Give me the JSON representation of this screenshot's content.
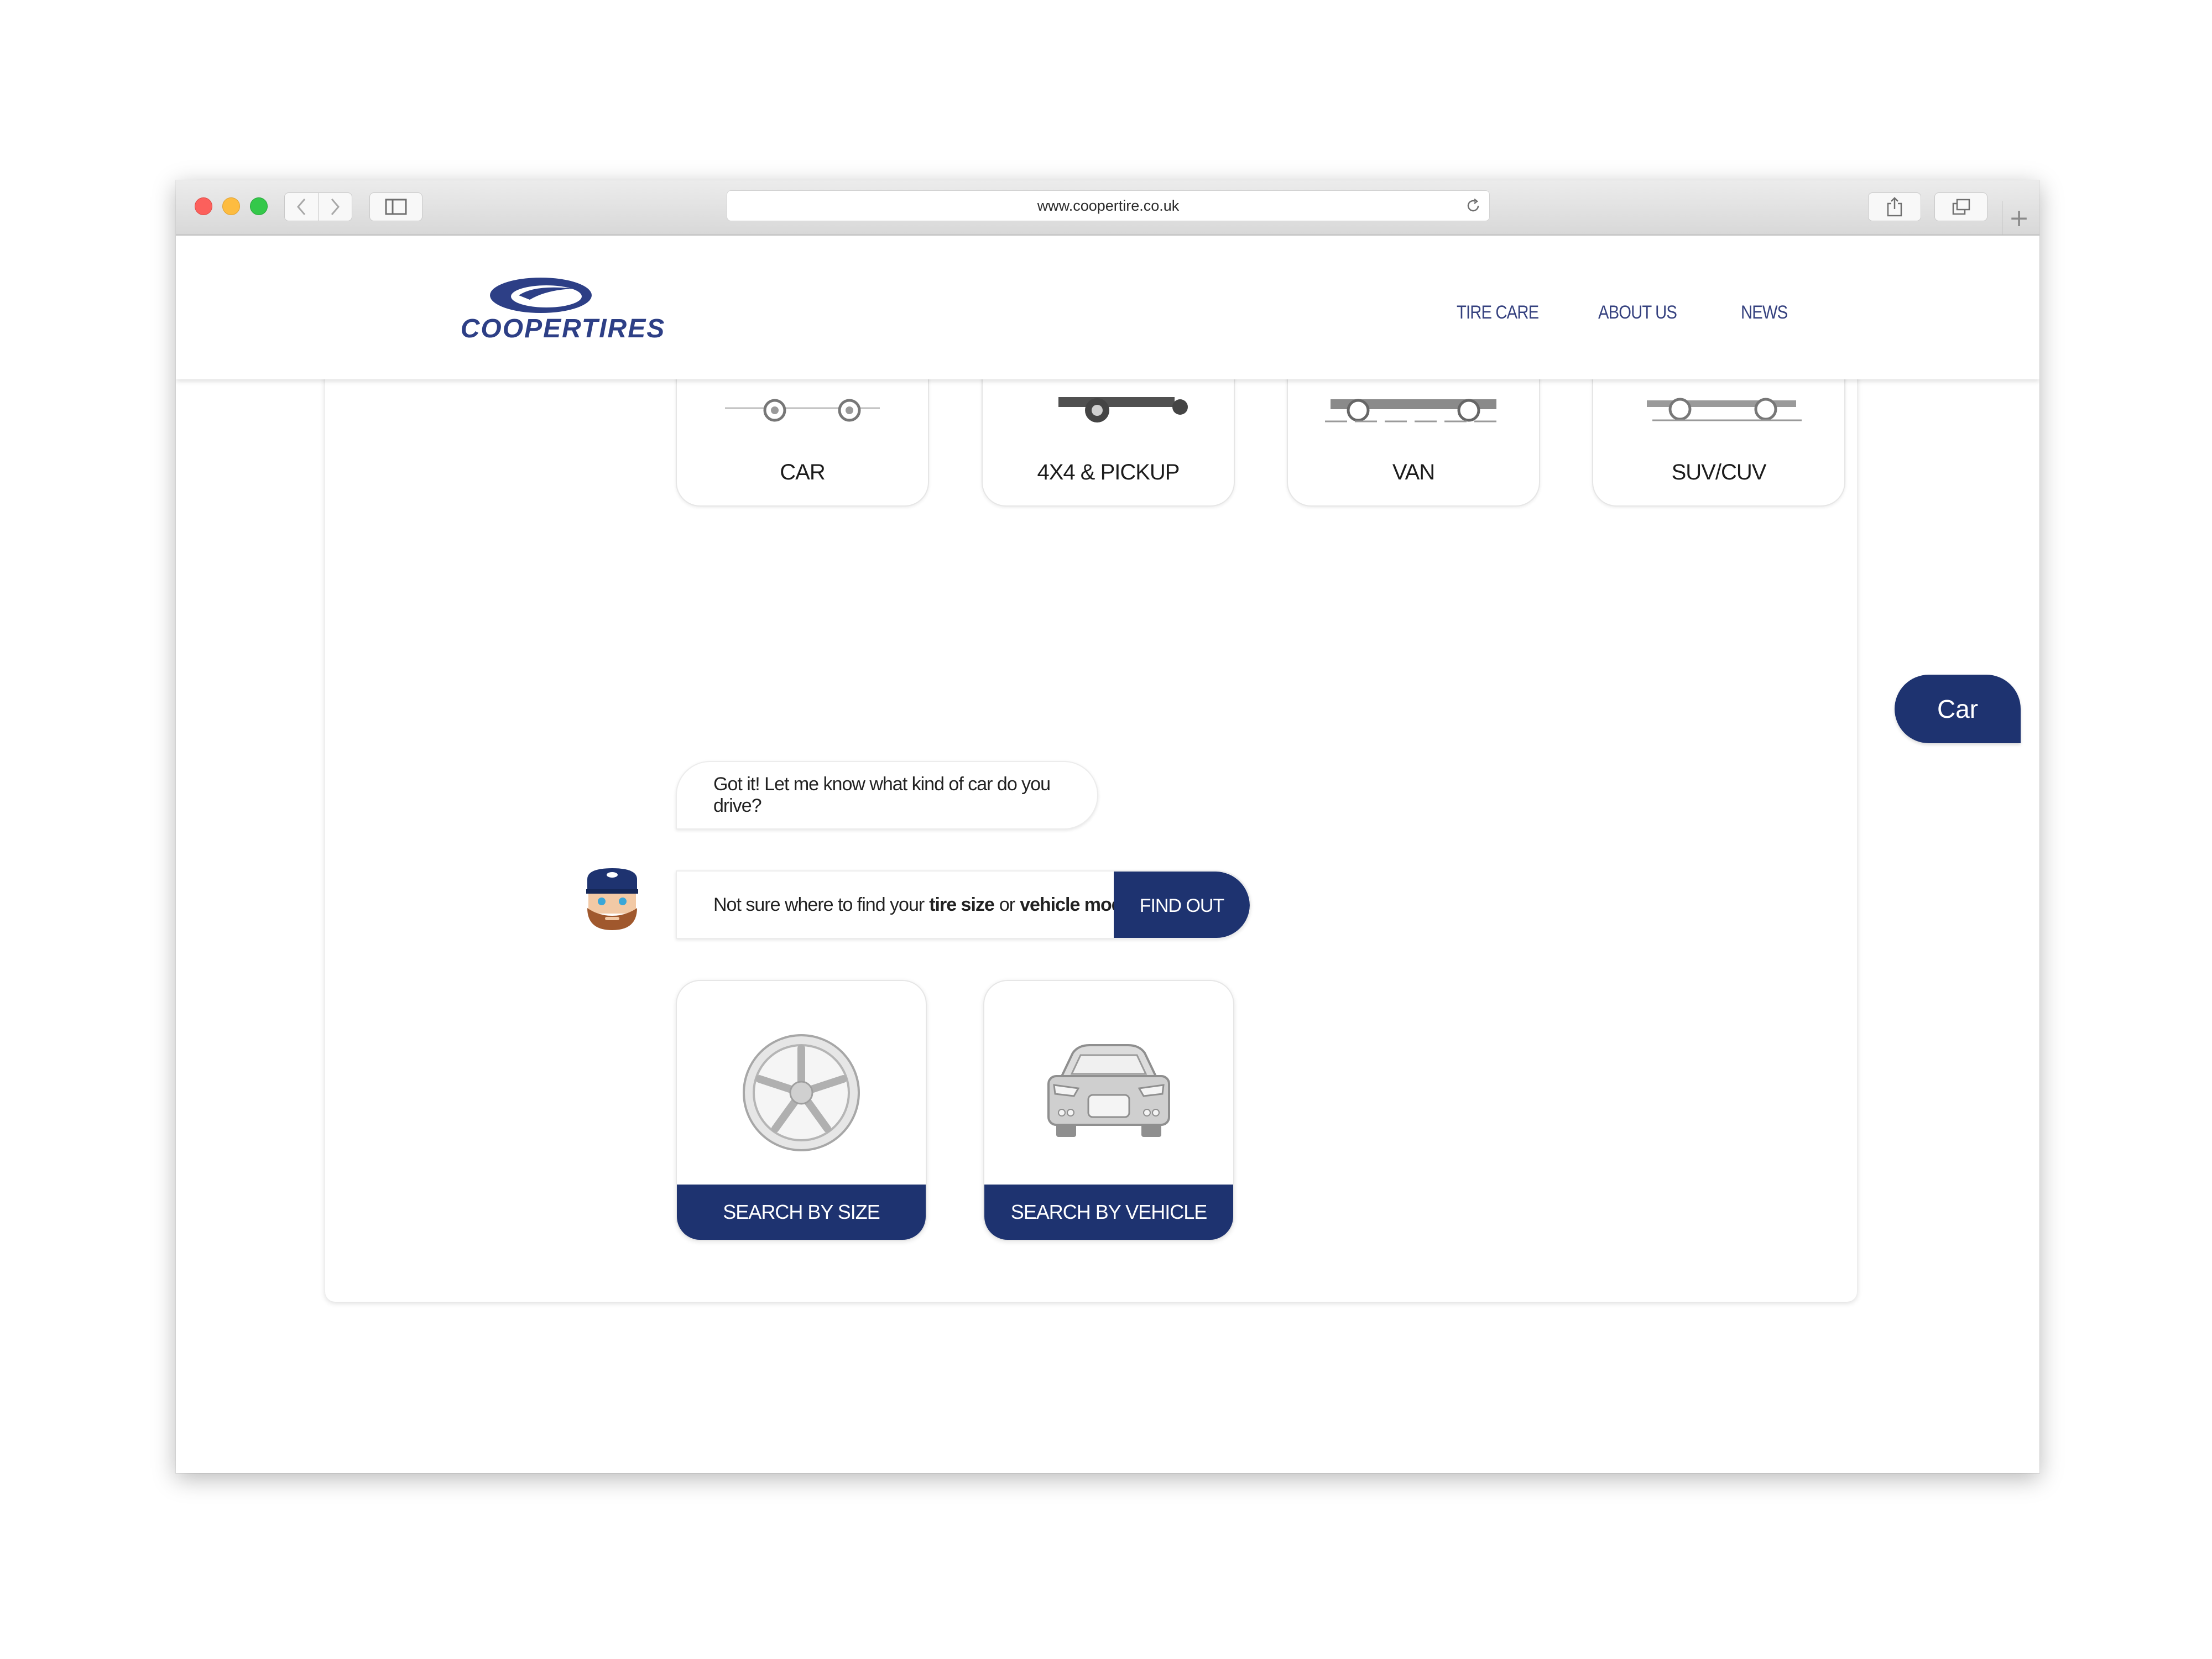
{
  "browser": {
    "url": "www.coopertire.co.uk",
    "new_tab_glyph": "+"
  },
  "header": {
    "logo_text": "COOPERTIRES",
    "nav": [
      {
        "label": "TIRE CARE"
      },
      {
        "label": "ABOUT US"
      },
      {
        "label": "NEWS"
      }
    ]
  },
  "chat": {
    "vehicle_types": [
      {
        "label": "CAR",
        "icon": "car-side-icon"
      },
      {
        "label": "4X4 & PICKUP",
        "icon": "pickup-icon"
      },
      {
        "label": "VAN",
        "icon": "van-icon"
      },
      {
        "label": "SUV/CUV",
        "icon": "suv-icon"
      }
    ],
    "user_reply": "Car",
    "bot_message": "Got it! Let me know what kind of car do you drive?",
    "help_message": {
      "prefix": "Not sure where to find your",
      "term1": "tire size",
      "connector": "or",
      "term2": "vehicle model",
      "suffix": "?",
      "button": "FIND OUT"
    },
    "search_options": [
      {
        "label": "SEARCH BY SIZE",
        "icon": "wheel-icon"
      },
      {
        "label": "SEARCH BY VEHICLE",
        "icon": "car-front-icon"
      }
    ]
  },
  "colors": {
    "brand_navy": "#1e3370",
    "nav_text": "#35417f"
  }
}
